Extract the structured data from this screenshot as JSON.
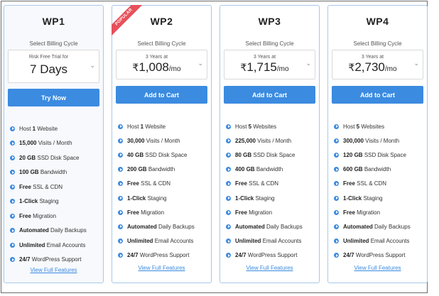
{
  "plans": [
    {
      "name": "WP1",
      "billing_label": "Select Billing Cycle",
      "select_top": "Risk Free Trial for",
      "select_main": "7 Days",
      "cta": "Try Now",
      "features": [
        {
          "bold": "",
          "text": "Host 1 Website"
        },
        {
          "bold": "15,000",
          "text": "Visits / Month"
        },
        {
          "bold": "20 GB",
          "text": "SSD Disk Space"
        },
        {
          "bold": "100 GB",
          "text": "Bandwidth"
        },
        {
          "bold": "Free",
          "text": "SSL & CDN"
        },
        {
          "bold": "1-Click",
          "text": "Staging"
        },
        {
          "bold": "Free",
          "text": "Migration"
        },
        {
          "bold": "Automated",
          "text": "Daily Backups"
        },
        {
          "bold": "Unlimited",
          "text": "Email Accounts"
        },
        {
          "bold": "24/7",
          "text": "WordPress Support"
        }
      ],
      "view_link": "View Full Features"
    },
    {
      "name": "WP2",
      "ribbon": "POPULAR",
      "billing_label": "Select Billing Cycle",
      "select_top": "3 Years at",
      "currency": "₹",
      "price": "1,008",
      "unit": "/mo",
      "cta": "Add to Cart",
      "features": [
        {
          "prefix": "Host ",
          "bold": "1",
          "text": "Website"
        },
        {
          "bold": "30,000",
          "text": "Visits / Month"
        },
        {
          "bold": "40 GB",
          "text": "SSD Disk Space"
        },
        {
          "bold": "200 GB",
          "text": "Bandwidth"
        },
        {
          "bold": "Free",
          "text": "SSL & CDN"
        },
        {
          "bold": "1-Click",
          "text": "Staging"
        },
        {
          "bold": "Free",
          "text": "Migration"
        },
        {
          "bold": "Automated",
          "text": "Daily Backups"
        },
        {
          "bold": "Unlimited",
          "text": "Email Accounts"
        },
        {
          "bold": "24/7",
          "text": "WordPress Support"
        }
      ],
      "view_link": "View Full Features"
    },
    {
      "name": "WP3",
      "billing_label": "Select Billing Cycle",
      "select_top": "3 Years at",
      "currency": "₹",
      "price": "1,715",
      "unit": "/mo",
      "cta": "Add to Cart",
      "features": [
        {
          "prefix": "Host ",
          "bold": "5",
          "text": "Websites"
        },
        {
          "bold": "225,000",
          "text": "Visits / Month"
        },
        {
          "bold": "80 GB",
          "text": "SSD Disk Space"
        },
        {
          "bold": "400 GB",
          "text": "Bandwidth"
        },
        {
          "bold": "Free",
          "text": "SSL & CDN"
        },
        {
          "bold": "1-Click",
          "text": "Staging"
        },
        {
          "bold": "Free",
          "text": "Migration"
        },
        {
          "bold": "Automated",
          "text": "Daily Backups"
        },
        {
          "bold": "Unlimited",
          "text": "Email Accounts"
        },
        {
          "bold": "24/7",
          "text": "WordPress Support"
        }
      ],
      "view_link": "View Full Features"
    },
    {
      "name": "WP4",
      "billing_label": "Select Billing Cycle",
      "select_top": "3 Years at",
      "currency": "₹",
      "price": "2,730",
      "unit": "/mo",
      "cta": "Add to Cart",
      "features": [
        {
          "prefix": "Host ",
          "bold": "5",
          "text": "Websites"
        },
        {
          "bold": "300,000",
          "text": "Visits / Month"
        },
        {
          "bold": "120 GB",
          "text": "SSD Disk Space"
        },
        {
          "bold": "600 GB",
          "text": "Bandwidth"
        },
        {
          "bold": "Free",
          "text": "SSL & CDN"
        },
        {
          "bold": "1-Click",
          "text": "Staging"
        },
        {
          "bold": "Free",
          "text": "Migration"
        },
        {
          "bold": "Automated",
          "text": "Daily Backups"
        },
        {
          "bold": "Unlimited",
          "text": "Email Accounts"
        },
        {
          "bold": "24/7",
          "text": "WordPress Support"
        }
      ],
      "view_link": "View Full Features"
    }
  ],
  "colors": {
    "accent": "#3b8be0",
    "ribbon": "#e8505b",
    "card_border": "#a8c8ea"
  }
}
